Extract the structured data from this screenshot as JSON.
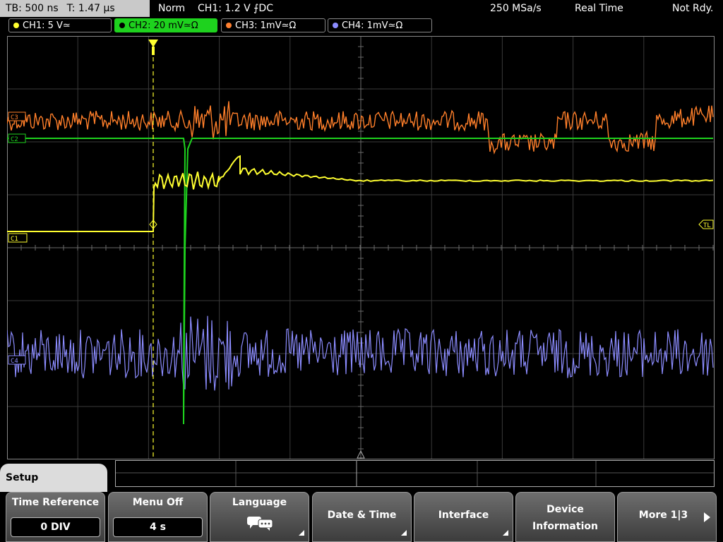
{
  "header": {
    "timebase": "TB: 500 ns",
    "trigger_time": "T: 1.47 µs",
    "mode": "Norm",
    "trigger_info": "CH1: 1.2 V ⨍DC",
    "sample_rate": "250 MSa/s",
    "acq_mode": "Real Time",
    "status": "Not Rdy."
  },
  "channels": [
    {
      "label": "CH1: 5 V≃",
      "color": "#ffff30"
    },
    {
      "label": "CH2: 20 mV≃Ω",
      "color": "#1ed21e"
    },
    {
      "label": "CH3: 1mV≃Ω",
      "color": "#ff8030"
    },
    {
      "label": "CH4: 1mV≃Ω",
      "color": "#8c8cff"
    }
  ],
  "markers": {
    "c1": "C1",
    "c2": "C2",
    "c3": "C3",
    "c4": "C4",
    "tl": "TL"
  },
  "menu": {
    "title": "Setup",
    "buttons": [
      {
        "label": "Time Reference",
        "value": "0 DIV"
      },
      {
        "label": "Menu Off",
        "value": "4 s"
      },
      {
        "label": "Language",
        "icon": "speech-bubble-icon"
      },
      {
        "label": "Date & Time"
      },
      {
        "label": "Interface"
      },
      {
        "label": "Device",
        "label2": "Information"
      },
      {
        "label": "More 1|3"
      }
    ]
  }
}
